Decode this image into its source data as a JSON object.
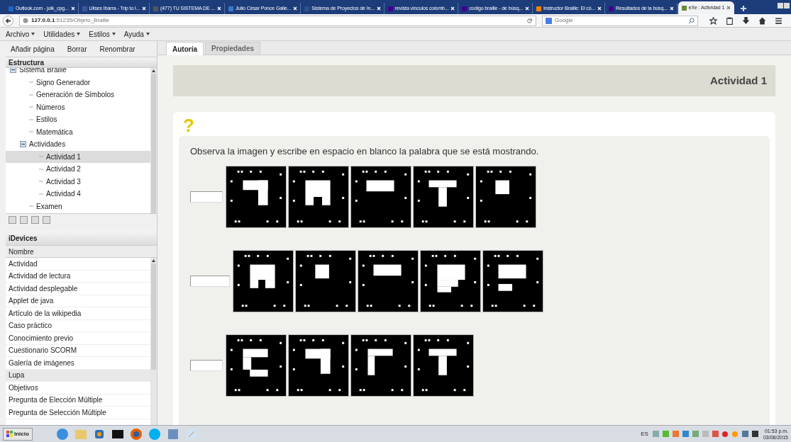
{
  "browser": {
    "tabs": [
      {
        "title": "Outlook.com - julk_cpg...",
        "color": "#1e66c8",
        "selected": false
      },
      {
        "title": "Ulises Ibarra - Trip to l...",
        "color": "#3b5998",
        "selected": false
      },
      {
        "title": "(477) TU SISTEMA DE ...",
        "color": "#555555",
        "selected": false
      },
      {
        "title": "Julio César Ponce Galle...",
        "color": "#3a78c9",
        "selected": false
      },
      {
        "title": "Sistema de Proyectos de In...",
        "color": "#2b4f8f",
        "selected": false
      },
      {
        "title": "revista vinculos colomb...",
        "color": "#400090",
        "selected": false
      },
      {
        "title": "codigo braille - de búsq...",
        "color": "#400090",
        "selected": false
      },
      {
        "title": "Instructor Braille: El có...",
        "color": "#f57d00",
        "selected": false
      },
      {
        "title": "Resultados de la búsq...",
        "color": "#400090",
        "selected": false
      },
      {
        "title": "eXe : Actividad 1",
        "color": "#6a8a3a",
        "selected": true
      }
    ],
    "address": {
      "host": "127.0.0.1",
      "path": ":51235/Objeto_Braille"
    },
    "search": {
      "placeholder": "Google"
    }
  },
  "menu": [
    "Archivo",
    "Utilidades",
    "Estilos",
    "Ayuda"
  ],
  "toolbar": [
    "Añadir página",
    "Borrar",
    "Renombrar"
  ],
  "structure": {
    "title": "Estructura",
    "tree": [
      {
        "label": "Sistema Braille",
        "expanded": true,
        "selected": false,
        "children": [
          {
            "label": "Signo Generador",
            "selected": false
          },
          {
            "label": "Generación de Símbolos",
            "selected": false
          },
          {
            "label": "Números",
            "selected": false
          },
          {
            "label": "Estilos",
            "selected": false
          },
          {
            "label": "Matemática",
            "selected": false
          },
          {
            "label": "Actividades",
            "expanded": true,
            "selected": false,
            "children": [
              {
                "label": "Actividad 1",
                "selected": true
              },
              {
                "label": "Actividad 2",
                "selected": false
              },
              {
                "label": "Actividad 3",
                "selected": false
              },
              {
                "label": "Actividad 4",
                "selected": false
              }
            ]
          },
          {
            "label": "Examen",
            "selected": false
          }
        ]
      }
    ]
  },
  "idevices": {
    "title": "iDevices",
    "column": "Nombre",
    "items": [
      {
        "label": "Actividad",
        "selected": false
      },
      {
        "label": "Actividad de lectura",
        "selected": false
      },
      {
        "label": "Actividad desplegable",
        "selected": false
      },
      {
        "label": "Applet de java",
        "selected": false
      },
      {
        "label": "Artículo de la wikipedia",
        "selected": false
      },
      {
        "label": "Caso práctico",
        "selected": false
      },
      {
        "label": "Conocimiento previo",
        "selected": false
      },
      {
        "label": "Cuestionario SCORM",
        "selected": false
      },
      {
        "label": "Galería de imágenes",
        "selected": false
      },
      {
        "label": "Lupa",
        "selected": true
      },
      {
        "label": "Objetivos",
        "selected": false
      },
      {
        "label": "Pregunta de Elección Múltiple",
        "selected": false
      },
      {
        "label": "Pregunta de Selección Múltiple",
        "selected": false
      }
    ]
  },
  "tabs": [
    {
      "label": "Autoría",
      "selected": true
    },
    {
      "label": "Propiedades",
      "selected": false
    }
  ],
  "page_title": "Actividad 1",
  "activity": {
    "icon": "?",
    "instruction": "Observa la imagen y escribe en espacio en blanco la palabra que se está mostrando.",
    "rows": [
      {
        "symbols": [
          {
            "kind": "hook"
          },
          {
            "kind": "checker"
          },
          {
            "kind": "bar"
          },
          {
            "kind": "tee"
          },
          {
            "kind": "square"
          }
        ]
      },
      {
        "symbols": [
          {
            "kind": "notch"
          },
          {
            "kind": "square"
          },
          {
            "kind": "bar"
          },
          {
            "kind": "step"
          },
          {
            "kind": "twobars"
          }
        ]
      },
      {
        "symbols": [
          {
            "kind": "cshape"
          },
          {
            "kind": "hook"
          },
          {
            "kind": "corner"
          },
          {
            "kind": "tee"
          }
        ]
      }
    ]
  },
  "taskbar": {
    "start": "Inicio",
    "language": "ES",
    "time": "01:53 p.m.",
    "date": "03/08/2015"
  }
}
